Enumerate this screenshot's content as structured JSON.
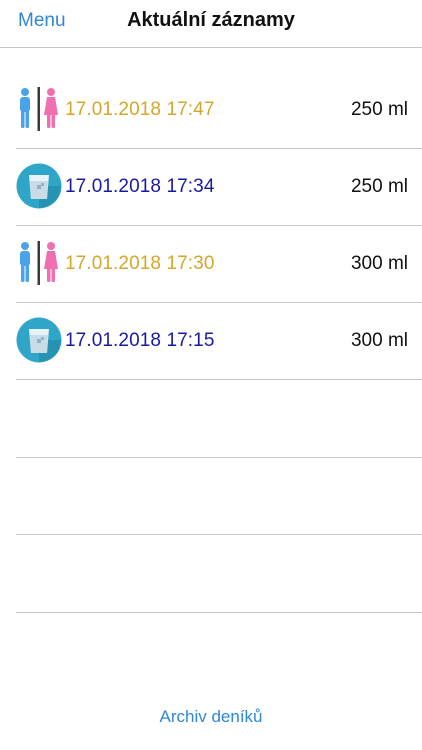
{
  "header": {
    "menu_label": "Menu",
    "title": "Aktuální záznamy"
  },
  "entries": [
    {
      "type": "toilet",
      "icon": "toilet-icon",
      "time": "17.01.2018 17:47",
      "amount": "250 ml"
    },
    {
      "type": "drink",
      "icon": "glass-of-water-icon",
      "time": "17.01.2018 17:34",
      "amount": "250 ml"
    },
    {
      "type": "toilet",
      "icon": "toilet-icon",
      "time": "17.01.2018 17:30",
      "amount": "300 ml"
    },
    {
      "type": "drink",
      "icon": "glass-of-water-icon",
      "time": "17.01.2018 17:15",
      "amount": "300 ml"
    }
  ],
  "footer": {
    "archive_label": "Archiv deníků"
  },
  "colors": {
    "accent": "#2f87d6",
    "toilet_time": "#d4a62a",
    "drink_time": "#1a1aa0",
    "male_figure": "#4aa3e8",
    "female_figure": "#ef6fb0",
    "glass_circle": "#2fa6c8"
  }
}
